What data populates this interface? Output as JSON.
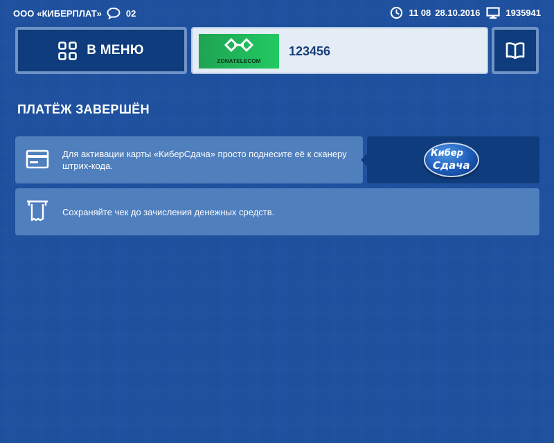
{
  "header": {
    "org_prefix": "ООО",
    "org_name": "«КИБЕРПЛАТ»",
    "messages_count": "02",
    "time": "11 08",
    "date": "28.10.2016",
    "terminal_id": "1935941"
  },
  "menu_button": {
    "label": "В МЕНЮ"
  },
  "provider": {
    "logo_text": "ZONATELECOM",
    "account": "123456"
  },
  "page_title": "ПЛАТЁЖ ЗАВЕРШЁН",
  "info_rows": [
    {
      "icon": "card-icon",
      "text": "Для активации карты «КиберСдача»  просто поднесите её к сканеру штрих-кода."
    },
    {
      "icon": "receipt-icon",
      "text": "Сохраняйте чек до зачисления денежных средств."
    }
  ],
  "cyber_logo": {
    "line1": "Кибер",
    "line2": "Сдача"
  },
  "colors": {
    "background": "#1a4d9c",
    "button_dark": "#0f3c7c",
    "button_border": "#6f93c6",
    "row_bg": "#4f7fbd",
    "provider_bg": "#e4ecf5",
    "logo_green": "#22c962"
  }
}
